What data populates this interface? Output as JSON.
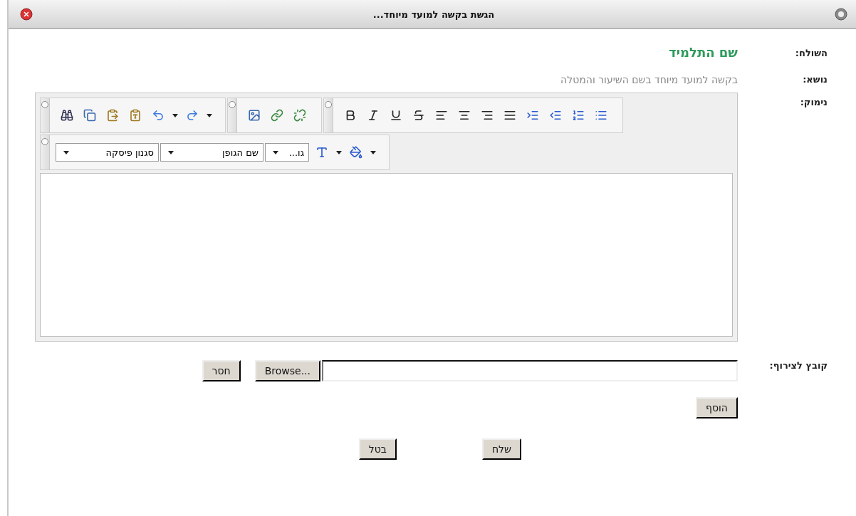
{
  "window": {
    "title": "הגשת בקשה למועד מיוחד..."
  },
  "form": {
    "sender": {
      "label": "השולח:",
      "value": "שם התלמיד"
    },
    "subject": {
      "label": "נושא:",
      "value": "בקשה למועד מיוחד בשם השיעור והמטלה"
    },
    "body": {
      "label": "נימוק:",
      "dropdowns": [
        {
          "value": "גו..."
        },
        {
          "value": "שם הגופן"
        },
        {
          "value": "סגנון פיסקה"
        }
      ]
    },
    "attachment": {
      "label": "קובץ לצירוף:",
      "browse_button": "Browse...",
      "remove_button": "חסר",
      "add_button": "הוסף"
    }
  },
  "buttons": [
    "שלח",
    "בטל"
  ]
}
